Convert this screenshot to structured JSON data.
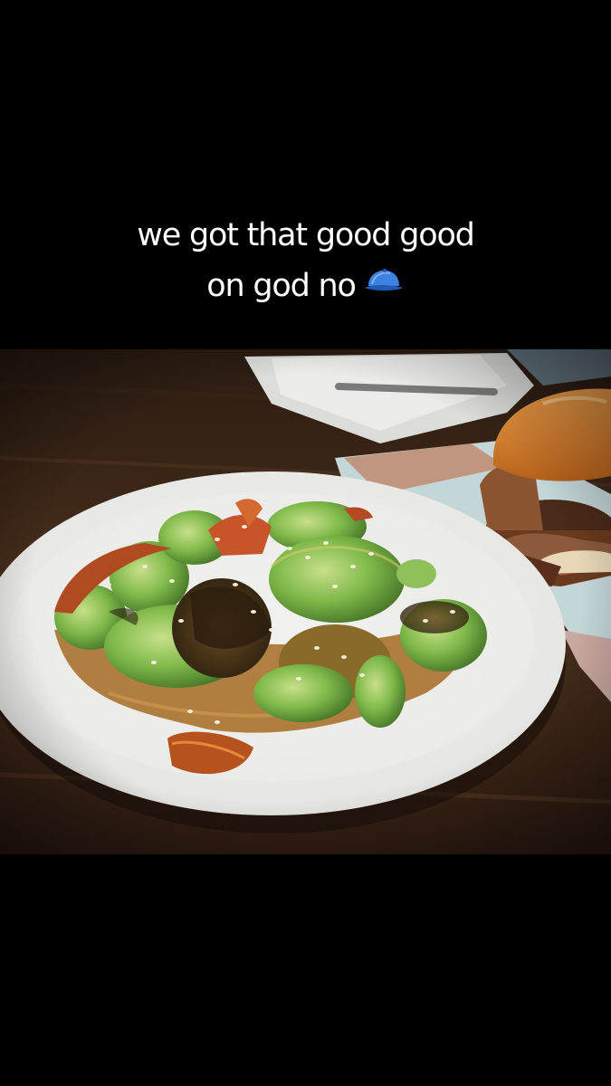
{
  "story": {
    "caption_line1": "we got that good good",
    "caption_line2": "on god no",
    "caption_emoji": "blue-cap-icon"
  },
  "colors": {
    "background": "#000000",
    "caption_text": "#ffffff",
    "cap_blue": "#3a7bd5"
  }
}
